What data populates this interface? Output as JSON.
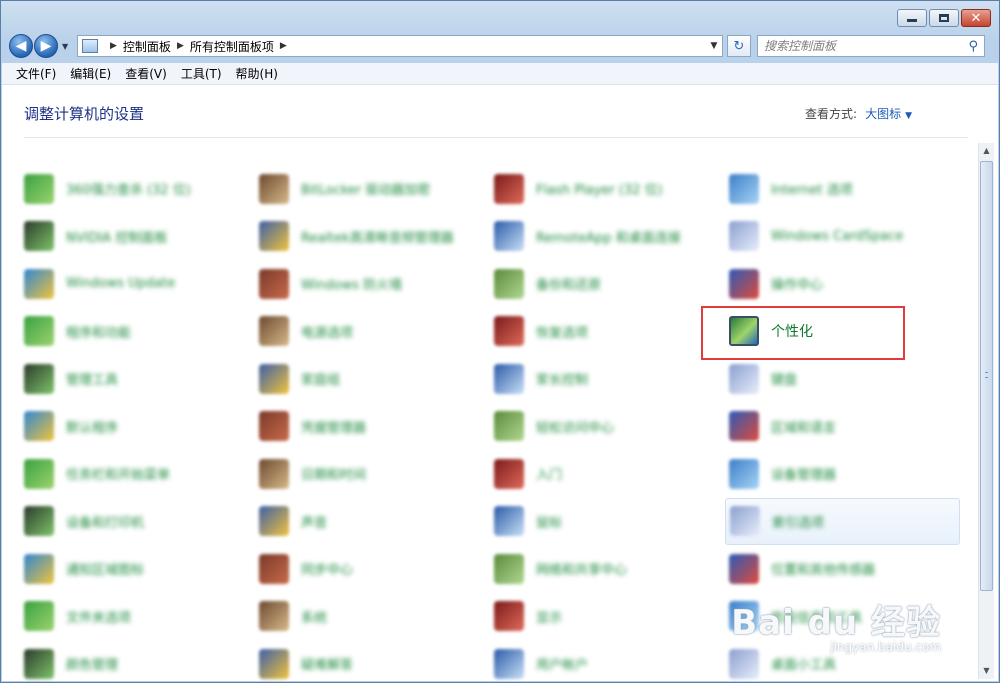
{
  "nav": {
    "breadcrumb": [
      "控制面板",
      "所有控制面板项"
    ],
    "search_placeholder": "搜索控制面板"
  },
  "menu": [
    "文件(F)",
    "编辑(E)",
    "查看(V)",
    "工具(T)",
    "帮助(H)"
  ],
  "header": {
    "title": "调整计算机的设置",
    "view_by_label": "查看方式:",
    "view_by_value": "大图标"
  },
  "items": [
    [
      "360强力查杀 (32 位)",
      "BitLocker 驱动器加密",
      "Flash Player (32 位)",
      "Internet 选项"
    ],
    [
      "NVIDIA 控制面板",
      "Realtek高清晰音频管理器",
      "RemoteApp 和桌面连接",
      "Windows CardSpace"
    ],
    [
      "Windows Update",
      "Windows 防火墙",
      "备份和还原",
      "操作中心"
    ],
    [
      "程序和功能",
      "电源选项",
      "恢复选项",
      "个性化"
    ],
    [
      "管理工具",
      "家庭组",
      "家长控制",
      "键盘"
    ],
    [
      "默认程序",
      "凭据管理器",
      "轻松访问中心",
      "区域和语言"
    ],
    [
      "任务栏和开始菜单",
      "日期和时间",
      "入门",
      "设备管理器"
    ],
    [
      "设备和打印机",
      "声音",
      "鼠标",
      "索引选项"
    ],
    [
      "通知区域图标",
      "同步中心",
      "网络和共享中心",
      "位置和其他传感器"
    ],
    [
      "文件夹选项",
      "系统",
      "显示",
      "性能信息和工具"
    ],
    [
      "颜色管理",
      "疑难解答",
      "用户帐户",
      "桌面小工具"
    ]
  ],
  "watermark": {
    "main": "Bai du 经验",
    "sub": "jingyan.baidu.com"
  }
}
